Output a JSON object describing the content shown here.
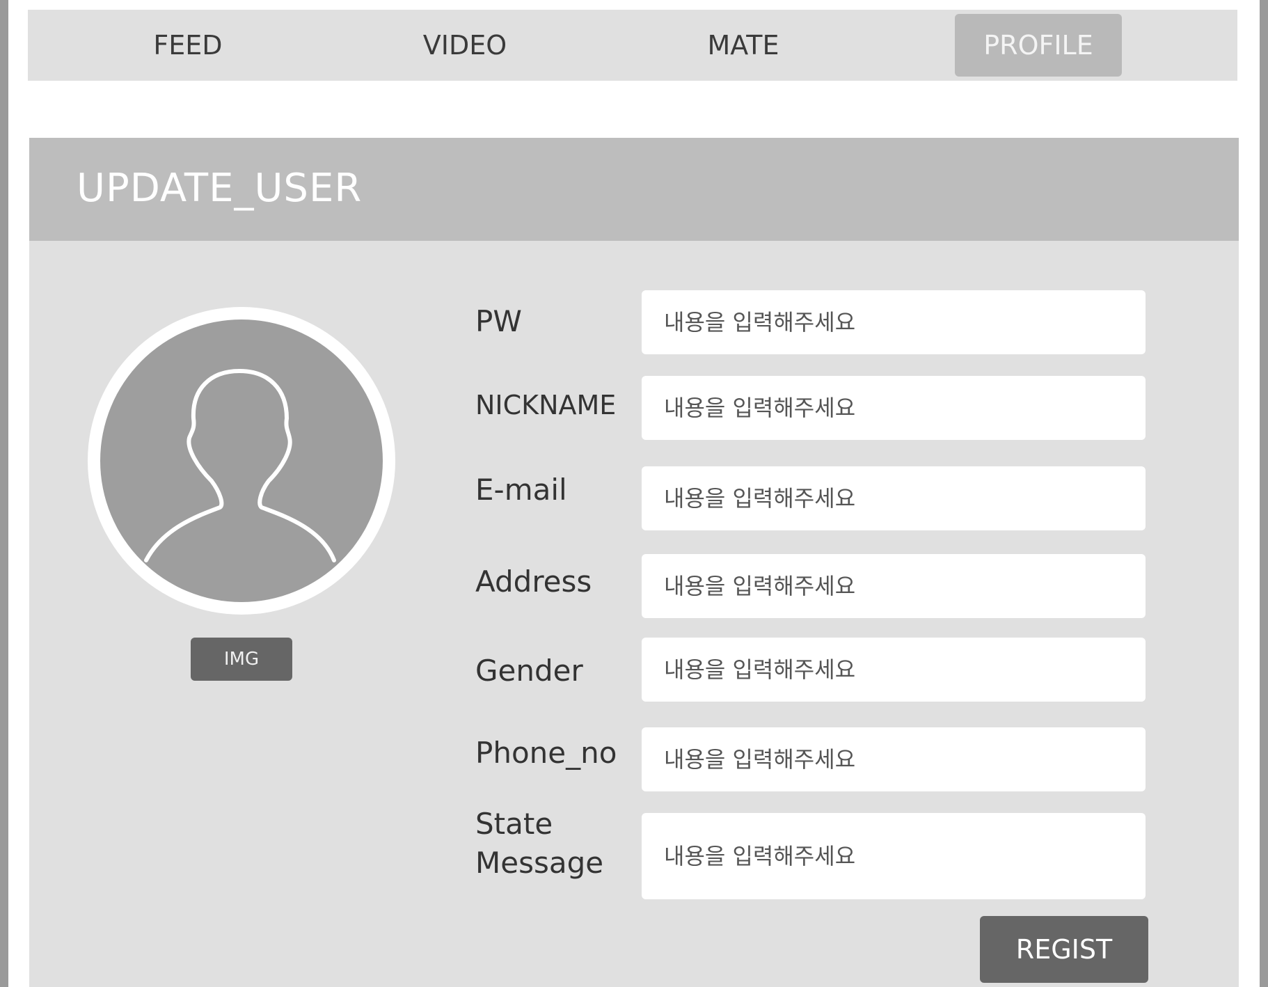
{
  "nav": {
    "items": [
      {
        "label": "FEED",
        "active": false
      },
      {
        "label": "VIDEO",
        "active": false
      },
      {
        "label": "MATE",
        "active": false
      },
      {
        "label": "PROFILE",
        "active": true
      }
    ]
  },
  "panel": {
    "title": "UPDATE_USER",
    "avatar_icon": "user-silhouette-icon",
    "img_button_label": "IMG",
    "fields": [
      {
        "label": "PW",
        "placeholder": "내용을 입력해주세요"
      },
      {
        "label": "NICKNAME",
        "placeholder": "내용을 입력해주세요"
      },
      {
        "label": "E-mail",
        "placeholder": "내용을 입력해주세요"
      },
      {
        "label": "Address",
        "placeholder": "내용을 입력해주세요"
      },
      {
        "label": "Gender",
        "placeholder": "내용을 입력해주세요"
      },
      {
        "label": "Phone_no",
        "placeholder": "내용을 입력해주세요"
      },
      {
        "label_line1": "State",
        "label_line2": "Message",
        "placeholder": "내용을 입력해주세요"
      }
    ],
    "submit_label": "REGIST"
  },
  "colors": {
    "nav_bg": "#e0e0e0",
    "nav_active_bg": "#b9b9b9",
    "panel_header_bg": "#bdbdbd",
    "panel_bg": "#e0e0e0",
    "button_bg": "#666666",
    "avatar_bg": "#9e9e9e"
  }
}
